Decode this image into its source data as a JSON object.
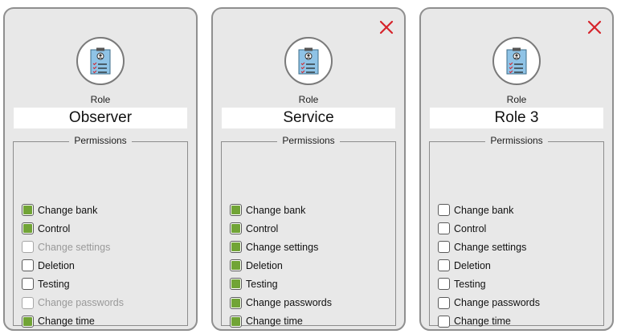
{
  "cards": [
    {
      "label": "Role",
      "name": "Observer",
      "closable": false,
      "permissions_title": "Permissions",
      "permissions": [
        {
          "label": "Change bank",
          "checked": true,
          "disabled": false
        },
        {
          "label": "Control",
          "checked": true,
          "disabled": false
        },
        {
          "label": "Change settings",
          "checked": false,
          "disabled": true
        },
        {
          "label": "Deletion",
          "checked": false,
          "disabled": false
        },
        {
          "label": "Testing",
          "checked": false,
          "disabled": false
        },
        {
          "label": "Change passwords",
          "checked": false,
          "disabled": true
        },
        {
          "label": "Change time",
          "checked": true,
          "disabled": false
        }
      ]
    },
    {
      "label": "Role",
      "name": "Service",
      "closable": true,
      "permissions_title": "Permissions",
      "permissions": [
        {
          "label": "Change bank",
          "checked": true,
          "disabled": false
        },
        {
          "label": "Control",
          "checked": true,
          "disabled": false
        },
        {
          "label": "Change settings",
          "checked": true,
          "disabled": false
        },
        {
          "label": "Deletion",
          "checked": true,
          "disabled": false
        },
        {
          "label": "Testing",
          "checked": true,
          "disabled": false
        },
        {
          "label": "Change passwords",
          "checked": true,
          "disabled": false
        },
        {
          "label": "Change time",
          "checked": true,
          "disabled": false
        }
      ]
    },
    {
      "label": "Role",
      "name": "Role 3",
      "closable": true,
      "permissions_title": "Permissions",
      "permissions": [
        {
          "label": "Change bank",
          "checked": false,
          "disabled": false
        },
        {
          "label": "Control",
          "checked": false,
          "disabled": false
        },
        {
          "label": "Change settings",
          "checked": false,
          "disabled": false
        },
        {
          "label": "Deletion",
          "checked": false,
          "disabled": false
        },
        {
          "label": "Testing",
          "checked": false,
          "disabled": false
        },
        {
          "label": "Change passwords",
          "checked": false,
          "disabled": false
        },
        {
          "label": "Change time",
          "checked": false,
          "disabled": false
        }
      ]
    }
  ],
  "colors": {
    "checked_fill": "#71a436",
    "close_icon": "#d6232a",
    "card_background": "#e8e8e8",
    "disabled_text": "#9a9a9a"
  },
  "icons": {
    "close": "close-icon",
    "role_avatar": "role-badge-icon",
    "checkbox": "checkbox-icon"
  }
}
